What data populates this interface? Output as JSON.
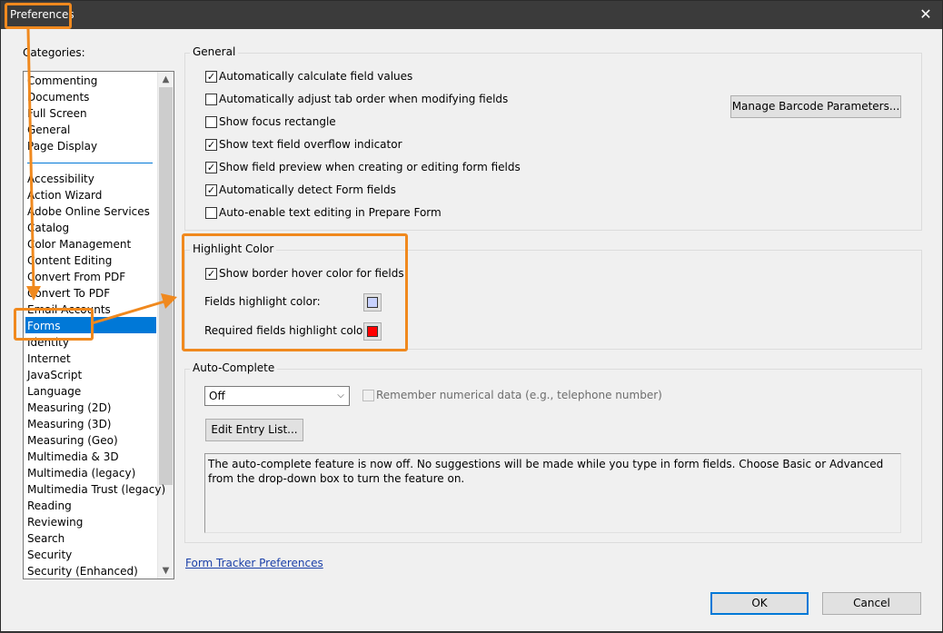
{
  "window": {
    "title": "Preferences",
    "close_glyph": "✕"
  },
  "categories": {
    "label": "Categories:",
    "top_items": [
      "Commenting",
      "Documents",
      "Full Screen",
      "General",
      "Page Display"
    ],
    "items": [
      "Accessibility",
      "Action Wizard",
      "Adobe Online Services",
      "Catalog",
      "Color Management",
      "Content Editing",
      "Convert From PDF",
      "Convert To PDF",
      "Email Accounts",
      "Forms",
      "Identity",
      "Internet",
      "JavaScript",
      "Language",
      "Measuring (2D)",
      "Measuring (3D)",
      "Measuring (Geo)",
      "Multimedia & 3D",
      "Multimedia (legacy)",
      "Multimedia Trust (legacy)",
      "Reading",
      "Reviewing",
      "Search",
      "Security",
      "Security (Enhanced)"
    ],
    "selected": "Forms"
  },
  "general": {
    "title": "General",
    "options": [
      {
        "label": "Automatically calculate field values",
        "checked": true
      },
      {
        "label": "Automatically adjust tab order when modifying fields",
        "checked": false
      },
      {
        "label": "Show focus rectangle",
        "checked": false
      },
      {
        "label": "Show text field overflow indicator",
        "checked": true
      },
      {
        "label": "Show field preview when creating or editing form fields",
        "checked": true
      },
      {
        "label": "Automatically detect Form fields",
        "checked": true
      },
      {
        "label": "Auto-enable text editing in Prepare Form",
        "checked": false
      }
    ],
    "barcode_button": "Manage Barcode Parameters..."
  },
  "highlight": {
    "title": "Highlight Color",
    "show_border_label": "Show border hover color for fields",
    "show_border_checked": true,
    "fields_label": "Fields highlight color:",
    "fields_color": "#c8d2ff",
    "required_label": "Required fields highlight color:",
    "required_color": "#ff0000"
  },
  "autocomplete": {
    "title": "Auto-Complete",
    "select_value": "Off",
    "remember_label": "Remember numerical data (e.g., telephone number)",
    "remember_checked": false,
    "edit_button": "Edit Entry List...",
    "description": "The auto-complete feature is now off. No suggestions will be made while you type in form fields. Choose Basic or Advanced from the drop-down box to turn the feature on."
  },
  "link": "Form Tracker Preferences",
  "footer": {
    "ok": "OK",
    "cancel": "Cancel"
  },
  "accent_color": "#f0891e",
  "selection_color": "#0078d7"
}
